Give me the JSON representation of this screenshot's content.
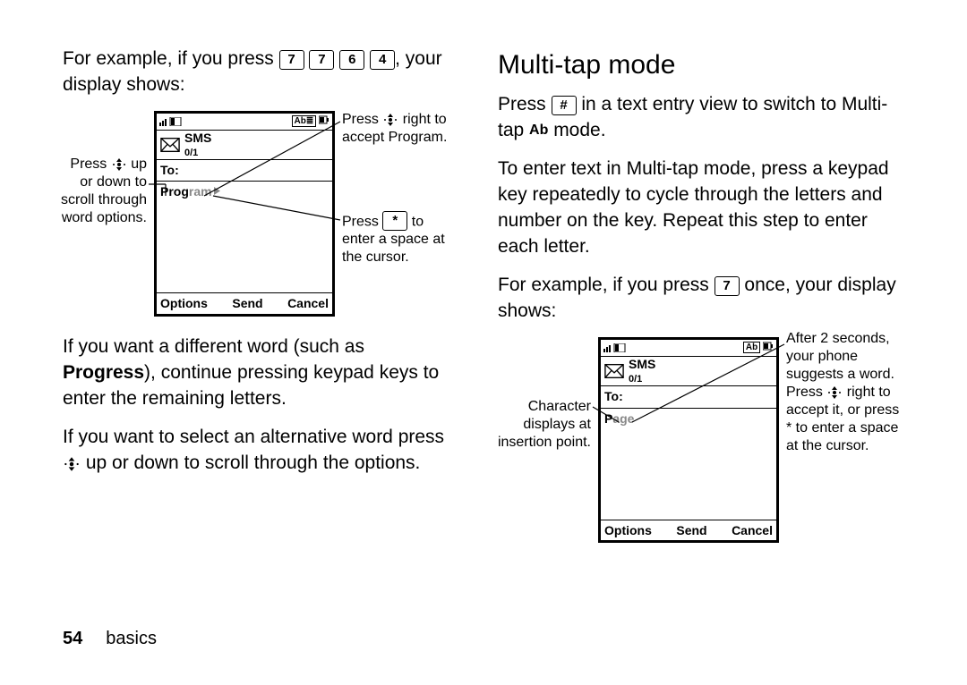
{
  "page": {
    "number": "54",
    "section": "basics"
  },
  "left": {
    "para1_a": "For example, if you press ",
    "para1_b": ", your display shows:",
    "keys_example1": [
      "7",
      "7",
      "6",
      "4"
    ],
    "para2_a": "If you want a different word (such as ",
    "para2_word": "Progress",
    "para2_b": "), continue pressing keypad keys to enter the remaining letters.",
    "para3_a": "If you want to select an alternative word press ",
    "para3_b": " up or down to scroll through the options."
  },
  "right": {
    "heading": "Multi-tap mode",
    "para1_a": "Press ",
    "key_hash": "#",
    "para1_b": " in a text entry view to switch to Multi-tap ",
    "ab": "Ab",
    "para1_c": " mode.",
    "para2": "To enter text in Multi-tap mode, press a keypad key repeatedly to cycle through the letters and number on the key. Repeat this step to enter each letter.",
    "para3_a": "For example, if you press ",
    "key_7": "7",
    "para3_b": " once, your display shows:"
  },
  "phone1": {
    "mode": "Ab≣",
    "title": "SMS",
    "count": "0/1",
    "to": "To:",
    "word_strong": "Prog",
    "word_ghost": "ram",
    "sk_left": "Options",
    "sk_mid": "Send",
    "sk_right": "Cancel",
    "callout_left": "Press       up or down to scroll through word options.",
    "callout_tr_a": "Press ",
    "callout_tr_b": " right to accept Program.",
    "callout_br_a": "Press ",
    "key_star": "*",
    "callout_br_b": " to enter a space at the cursor."
  },
  "phone2": {
    "mode": "Ab",
    "title": "SMS",
    "count": "0/1",
    "to": "To:",
    "word_strong": "P",
    "word_ghost": "age",
    "sk_left": "Options",
    "sk_mid": "Send",
    "sk_right": "Cancel",
    "callout_left": "Character displays at insertion point.",
    "callout_right_a": "After 2 seconds, your phone suggests a word. Press ",
    "callout_right_b": " right to accept it, or press * to enter a space at the cursor."
  }
}
